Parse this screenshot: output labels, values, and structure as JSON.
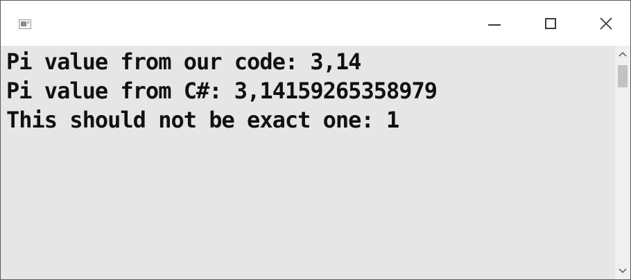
{
  "window": {
    "controls": {
      "minimize_icon": "minimize-icon",
      "maximize_icon": "maximize-icon",
      "close_icon": "close-icon"
    },
    "app_icon": "console-app-icon"
  },
  "console": {
    "lines": [
      "Pi value from our code: 3,14",
      "Pi value from C#: 3,14159265358979",
      "This should not be exact one: 1"
    ],
    "background": "#e6e6e6",
    "text_color": "#111111"
  },
  "scrollbar": {
    "up_icon": "chevron-up-icon",
    "down_icon": "chevron-down-icon"
  }
}
